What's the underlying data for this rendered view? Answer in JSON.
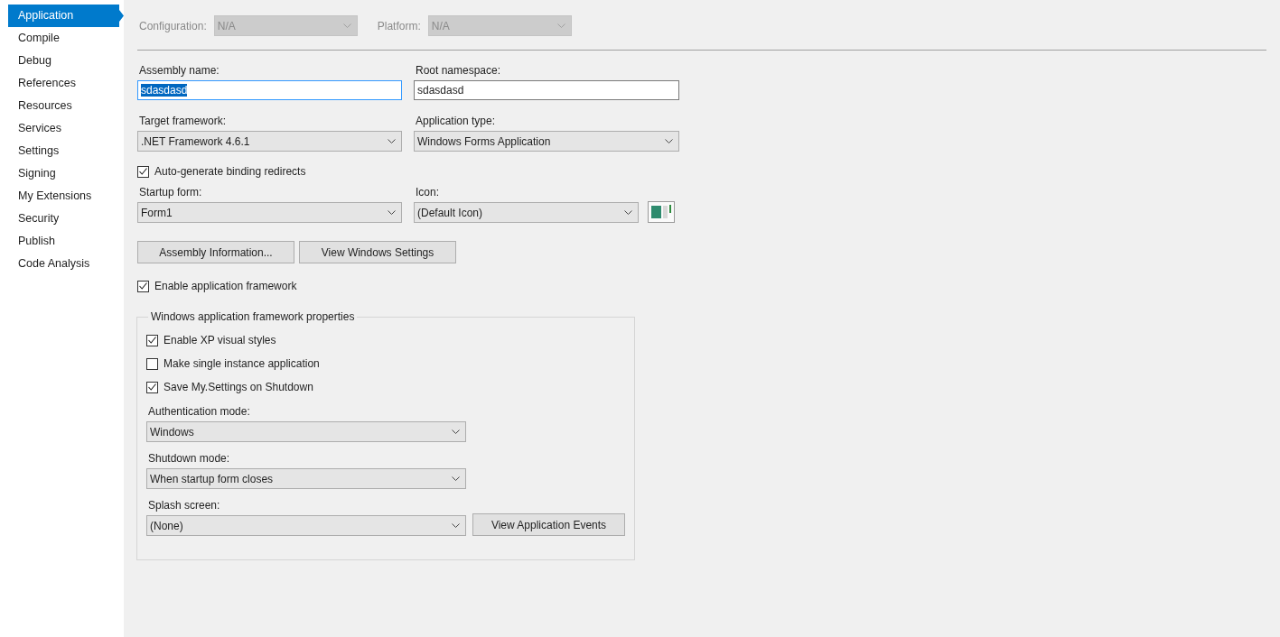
{
  "sidebar": {
    "items": [
      {
        "label": "Application",
        "selected": true
      },
      {
        "label": "Compile",
        "selected": false
      },
      {
        "label": "Debug",
        "selected": false
      },
      {
        "label": "References",
        "selected": false
      },
      {
        "label": "Resources",
        "selected": false
      },
      {
        "label": "Services",
        "selected": false
      },
      {
        "label": "Settings",
        "selected": false
      },
      {
        "label": "Signing",
        "selected": false
      },
      {
        "label": "My Extensions",
        "selected": false
      },
      {
        "label": "Security",
        "selected": false
      },
      {
        "label": "Publish",
        "selected": false
      },
      {
        "label": "Code Analysis",
        "selected": false
      }
    ]
  },
  "config_bar": {
    "disabled": true,
    "configuration_label": "Configuration:",
    "configuration_value": "N/A",
    "platform_label": "Platform:",
    "platform_value": "N/A"
  },
  "assembly_name": {
    "label": "Assembly name:",
    "value": "sdasdasd",
    "text_selected": true
  },
  "root_namespace": {
    "label": "Root namespace:",
    "value": "sdasdasd",
    "text_selected": false
  },
  "target_framework": {
    "label": "Target framework:",
    "value": ".NET Framework 4.6.1"
  },
  "application_type": {
    "label": "Application type:",
    "value": "Windows Forms Application"
  },
  "binding_redirects": {
    "label": "Auto-generate binding redirects",
    "checked": true
  },
  "startup_form": {
    "label": "Startup form:",
    "value": "Form1"
  },
  "icon": {
    "label": "Icon:",
    "value": "(Default Icon)"
  },
  "buttons": [
    "Assembly Information...",
    "View Windows Settings"
  ],
  "enable_framework": {
    "label": "Enable application framework",
    "checked": true
  },
  "framework_group": {
    "title": "Windows application framework properties",
    "options": [
      {
        "label": "Enable XP visual styles",
        "checked": true
      },
      {
        "label": "Make single instance application",
        "checked": false
      },
      {
        "label": "Save My.Settings on Shutdown",
        "checked": true
      }
    ],
    "authentication_mode": {
      "label": "Authentication mode:",
      "value": "Windows"
    },
    "shutdown_mode": {
      "label": "Shutdown mode:",
      "value": "When startup form closes"
    },
    "splash_screen": {
      "label": "Splash screen:",
      "value": "(None)"
    },
    "events_button": "View Application Events"
  }
}
